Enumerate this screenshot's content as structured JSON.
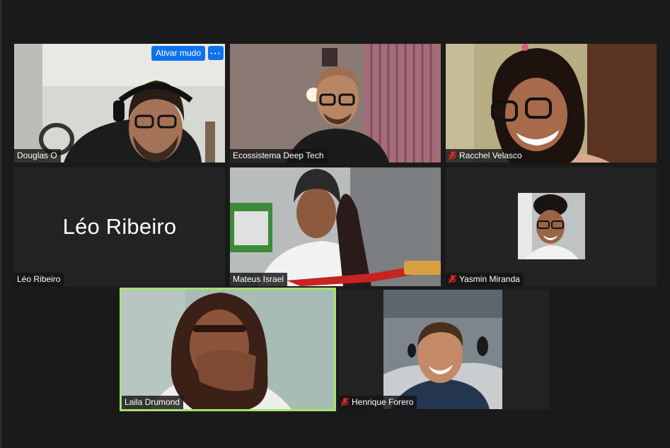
{
  "participants": [
    {
      "name": "Douglas O",
      "muted": false
    },
    {
      "name": "Ecossistema Deep Tech",
      "muted": false
    },
    {
      "name": "Racchel Velasco",
      "muted": true
    },
    {
      "name": "Léo Ribeiro",
      "muted": false,
      "video": false,
      "display_name": "Léo Ribeiro"
    },
    {
      "name": "Mateus Israel",
      "muted": false
    },
    {
      "name": "Yasmin Miranda",
      "muted": true
    },
    {
      "name": "Laila Drumond",
      "muted": false,
      "active_speaker": true
    },
    {
      "name": "Henrique Forero",
      "muted": true
    }
  ],
  "tile_controls": {
    "unmute_label": "Ativar mudo",
    "more_label": "···"
  },
  "icons": {
    "mute": "microphone-muted-icon",
    "more": "more-icon"
  },
  "colors": {
    "background": "#1a1a1a",
    "tile": "#232323",
    "accent": "#0e72ed",
    "active_border": "#a6e36a",
    "mute_red": "#e02828"
  }
}
